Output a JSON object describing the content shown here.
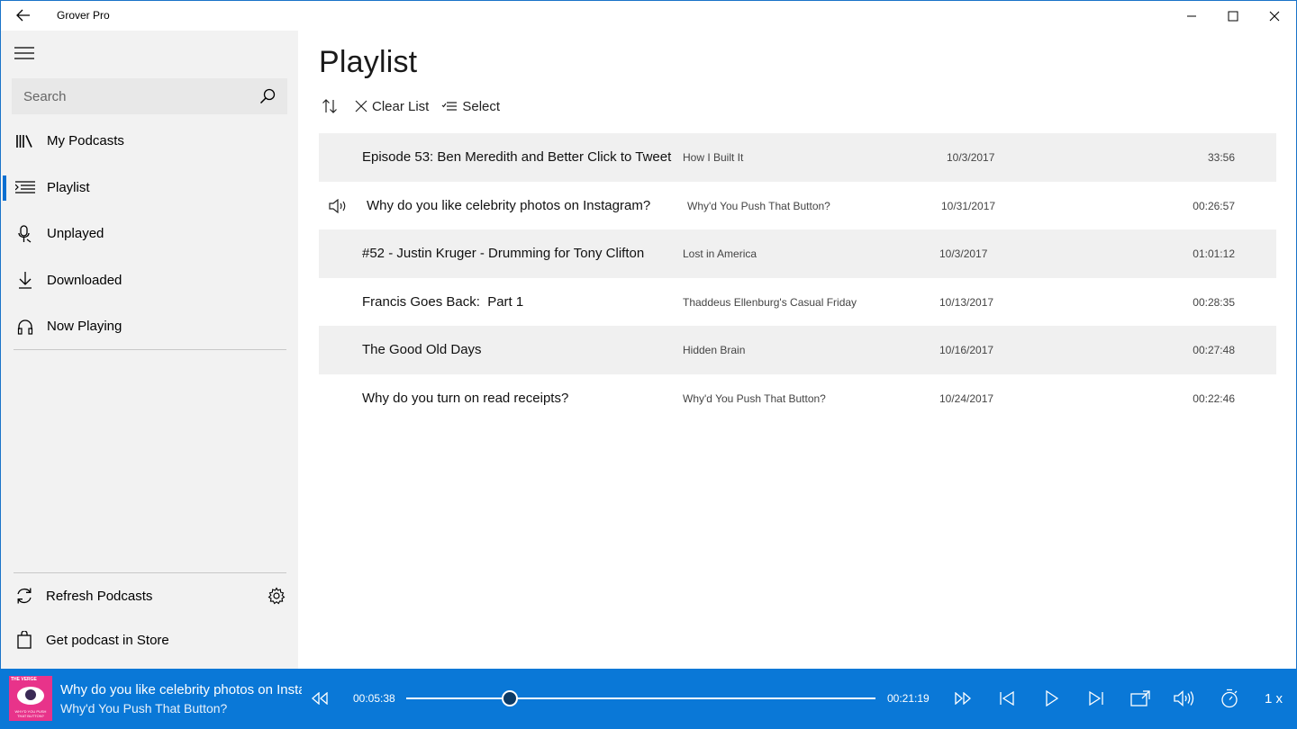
{
  "app": {
    "title": "Grover Pro"
  },
  "sidebar": {
    "search_placeholder": "Search",
    "items": [
      {
        "label": "My Podcasts",
        "icon": "library-icon"
      },
      {
        "label": "Playlist",
        "icon": "playlist-icon",
        "active": true
      },
      {
        "label": "Unplayed",
        "icon": "unplayed-icon"
      },
      {
        "label": "Downloaded",
        "icon": "download-icon"
      },
      {
        "label": "Now Playing",
        "icon": "headphones-icon"
      }
    ],
    "refresh_label": "Refresh Podcasts",
    "store_label": "Get podcast in Store"
  },
  "main": {
    "title": "Playlist",
    "toolbar": {
      "clear_label": "Clear List",
      "select_label": "Select"
    },
    "episodes": [
      {
        "title": "Episode 53: Ben Meredith and Better Click to Tweet",
        "podcast": "How I Built It",
        "date": "10/3/2017",
        "duration": "33:56",
        "playing": false
      },
      {
        "title": "Why do you like celebrity photos on Instagram?",
        "podcast": "Why'd You Push That Button?",
        "date": "10/31/2017",
        "duration": "00:26:57",
        "playing": true
      },
      {
        "title": "#52 - Justin Kruger - Drumming for Tony Clifton",
        "podcast": "Lost in America",
        "date": "10/3/2017",
        "duration": "01:01:12",
        "playing": false
      },
      {
        "title": "Francis Goes Back:  Part 1",
        "podcast": "Thaddeus Ellenburg's Casual Friday",
        "date": "10/13/2017",
        "duration": "00:28:35",
        "playing": false
      },
      {
        "title": "The Good Old Days",
        "podcast": "Hidden Brain",
        "date": "10/16/2017",
        "duration": "00:27:48",
        "playing": false
      },
      {
        "title": "Why do you turn on read receipts?",
        "podcast": "Why'd You Push That Button?",
        "date": "10/24/2017",
        "duration": "00:22:46",
        "playing": false
      }
    ]
  },
  "player": {
    "title": "Why do you like celebrity photos on Instagram?",
    "podcast": "Why'd You Push That Button?",
    "art_brand": "THE VERGE",
    "art_caption": "WHY'D YOU PUSH THAT BUTTON?",
    "elapsed": "00:05:38",
    "remaining": "00:21:19",
    "progress": 0.22,
    "speed": "1 x"
  },
  "colors": {
    "accent": "#0a78d7",
    "sidebar_bg": "#f2f2f2",
    "row_alt": "#f0f0f0"
  }
}
